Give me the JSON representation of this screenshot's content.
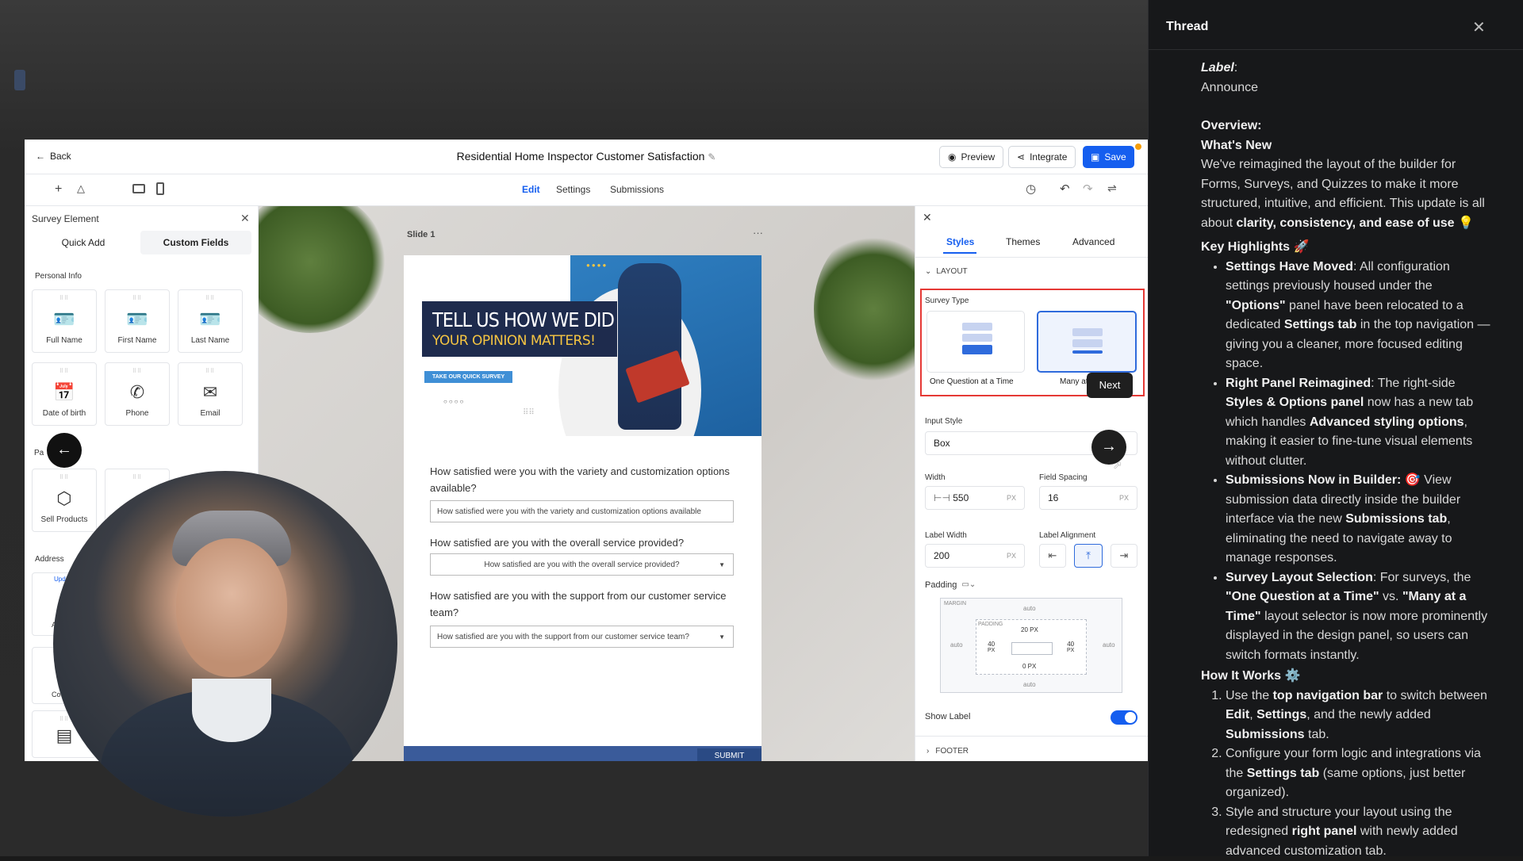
{
  "header": {
    "back": "Back",
    "title": "Residential Home Inspector Customer Satisfaction",
    "preview": "Preview",
    "integrate": "Integrate",
    "save": "Save"
  },
  "nav": {
    "edit": "Edit",
    "settings": "Settings",
    "submissions": "Submissions"
  },
  "left_panel": {
    "title": "Survey Element",
    "tabs": [
      "Quick Add",
      "Custom Fields"
    ],
    "section_personal": "Personal Info",
    "cards": [
      "Full Name",
      "First Name",
      "Last Name",
      "Date of birth",
      "Phone",
      "Email",
      "Sell Products"
    ],
    "section_pa": "Pa",
    "section_address": "Address",
    "partial_upd": "Upd",
    "partial_a": "A",
    "partial_co": "Co"
  },
  "slide": {
    "label": "Slide 1",
    "hero_line1": "TELL US HOW WE DID",
    "hero_line2": "YOUR OPINION MATTERS!",
    "hero_cta": "TAKE OUR QUICK SURVEY",
    "questions": [
      {
        "q": "How satisfied were you with the variety and customization options available?",
        "value": "How satisfied were you with the variety and customization options available"
      },
      {
        "q": "How satisfied are you with the overall service provided?",
        "value": "How satisfied are you with the overall service provided?"
      },
      {
        "q": "How satisfied are you with the support from our customer service team?",
        "value": "How satisfied are you with the support from our customer service team?"
      }
    ],
    "submit": "SUBMIT"
  },
  "right_panel": {
    "tabs": [
      "Styles",
      "Themes",
      "Advanced"
    ],
    "layout_section": "LAYOUT",
    "survey_type": "Survey Type",
    "type_one": "One Question at a Time",
    "type_many": "Many at",
    "tooltip": "Next",
    "input_style_label": "Input Style",
    "input_style": "Box",
    "width_label": "Width",
    "width": "550",
    "spacing_label": "Field Spacing",
    "spacing": "16",
    "label_width_label": "Label Width",
    "label_width": "200",
    "label_align_label": "Label Alignment",
    "padding_label": "Padding",
    "unit": "PX",
    "margin": "MARGIN",
    "padding": "PADDING",
    "auto": "auto",
    "pad_top": "20 PX",
    "pad_left": "40",
    "pad_right": "40",
    "pad_bottom": "0 PX",
    "px": "PX",
    "show_label": "Show Label",
    "footer": "FOOTER"
  },
  "thread": {
    "title": "Thread",
    "label_key": "Label",
    "label_val": "Announce",
    "overview": "Overview:",
    "whats_new": "What's New",
    "intro": "We've reimagined the layout of the builder for Forms, Surveys, and Quizzes to make it more structured, intuitive, and efficient. This update is all about ",
    "intro_b": "clarity, consistency, and ease of use",
    "bulb": "💡",
    "key_h": "Key Highlights",
    "rocket": "🚀",
    "h1_t": "Settings Have Moved",
    "h1_a": ": All configuration settings previously housed under the ",
    "h1_b": "\"Options\"",
    "h1_c": " panel have been relocated to a dedicated ",
    "h1_d": "Settings tab",
    "h1_e": " in the top navigation —giving you a cleaner, more focused editing space.",
    "h2_t": "Right Panel Reimagined",
    "h2_a": ": The right-side ",
    "h2_b": "Styles & Options panel",
    "h2_c": " now has a new tab which handles ",
    "h2_d": "Advanced styling options",
    "h2_e": ", making it easier to fine-tune visual elements without clutter.",
    "h3_t": "Submissions Now in Builder:",
    "h3_emoji": "🎯",
    "h3_a": " View submission data directly inside the builder interface via the new ",
    "h3_b": "Submissions tab",
    "h3_c": ", eliminating the need to navigate away to manage responses.",
    "h4_t": "Survey Layout Selection",
    "h4_a": ": For surveys, the ",
    "h4_b": "\"One Question at a Time\"",
    "h4_c": " vs. ",
    "h4_d": "\"Many at a Time\"",
    "h4_e": " layout selector is now more prominently displayed in the design panel, so users can switch formats instantly.",
    "how": "How It Works",
    "gear": "⚙️",
    "s1_a": "Use the ",
    "s1_b": "top navigation bar",
    "s1_c": " to switch between ",
    "s1_d": "Edit",
    "s1_e": ", ",
    "s1_f": "Settings",
    "s1_g": ", and the newly added ",
    "s1_h": "Submissions",
    "s1_i": " tab.",
    "s2_a": "Configure your form logic and integrations via the ",
    "s2_b": "Settings tab",
    "s2_c": " (same options, just better organized).",
    "s3_a": "Style and structure your layout using the redesigned ",
    "s3_b": "right panel",
    "s3_c": " with newly added advanced customization tab."
  },
  "colors": {
    "accent": "#155eef",
    "highlight": "#e53935",
    "thread_bg": "#17181a",
    "hero_dark": "#1e2b4d",
    "hero_gold": "#f5c542"
  }
}
